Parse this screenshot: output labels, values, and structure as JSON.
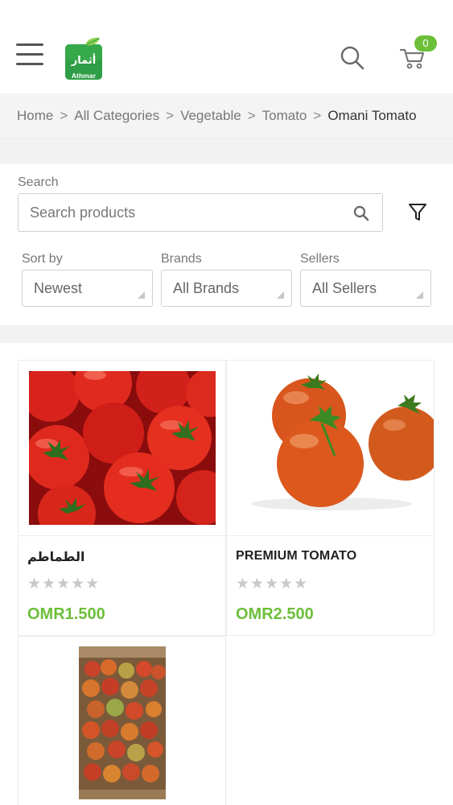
{
  "header": {
    "logo_text_en": "Athmar",
    "logo_text_ar": "أثمار",
    "cart_count": "0",
    "brand_color": "#6dbf3a"
  },
  "breadcrumb": {
    "items": [
      "Home",
      "All Categories",
      "Vegetable",
      "Tomato"
    ],
    "separator": ">",
    "current": "Omani Tomato"
  },
  "filters": {
    "search_label": "Search",
    "search_placeholder": "Search products",
    "sort_label": "Sort by",
    "sort_value": "Newest",
    "brands_label": "Brands",
    "brands_value": "All Brands",
    "sellers_label": "Sellers",
    "sellers_value": "All Sellers"
  },
  "products": [
    {
      "name": "الطماطم",
      "price": "OMR1.500",
      "stars": "★★★★★",
      "rating": 0,
      "image": "tomatoes-pile"
    },
    {
      "name": "PREMIUM TOMATO",
      "price": "OMR2.500",
      "stars": "★★★★★",
      "rating": 0,
      "image": "tomatoes-three"
    },
    {
      "name": "",
      "price": "",
      "stars": "",
      "rating": 0,
      "image": "tomatoes-crate"
    }
  ]
}
